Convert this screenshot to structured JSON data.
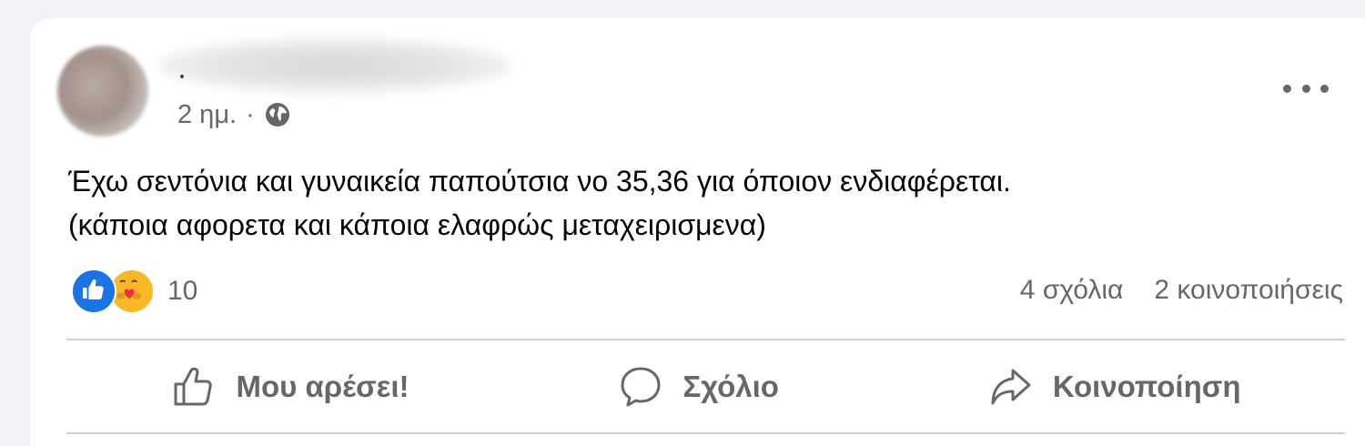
{
  "post": {
    "time": "2 ημ.",
    "separator": "·",
    "text_lines": [
      "Έχω σεντόνια και γυναικεία παπούτσια νο 35,36 για όποιον ενδιαφέρεται.",
      "(κάποια αφορετα και κάποια ελαφρώς μεταχειρισμενα)"
    ],
    "audience_icon": "globe-icon",
    "menu_icon": "more-options-icon"
  },
  "reactions": {
    "count": "10",
    "types": [
      "like",
      "care"
    ],
    "like_color": "#1b74e4",
    "care_color": "#f7b928"
  },
  "stats": {
    "comments": "4 σχόλια",
    "shares": "2 κοινοποιήσεις"
  },
  "actions": {
    "like_label": "Μου αρέσει!",
    "comment_label": "Σχόλιο",
    "share_label": "Κοινοποίηση"
  },
  "colors": {
    "background": "#f0f2f5",
    "card": "#ffffff",
    "secondary_text": "#65676b",
    "primary_text": "#050505",
    "divider": "#ced0d4"
  }
}
